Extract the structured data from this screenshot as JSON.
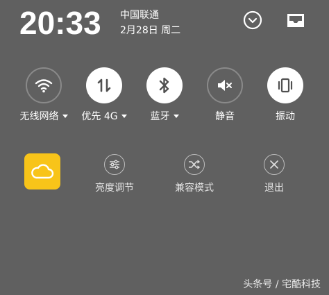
{
  "status": {
    "time": "20:33",
    "carrier": "中国联通",
    "date": "2月28日 周二"
  },
  "header_icons": [
    {
      "icon": "chevron-down-circle-icon"
    },
    {
      "icon": "inbox-icon"
    }
  ],
  "toggles": [
    {
      "label": "无线网络",
      "icon": "wifi-icon",
      "state": "off",
      "has_dropdown": true
    },
    {
      "label": "优先 4G",
      "icon": "mobile-data-icon",
      "state": "on",
      "has_dropdown": true
    },
    {
      "label": "蓝牙",
      "icon": "bluetooth-icon",
      "state": "on",
      "has_dropdown": true
    },
    {
      "label": "静音",
      "icon": "mute-icon",
      "state": "off",
      "has_dropdown": false
    },
    {
      "label": "振动",
      "icon": "vibrate-icon",
      "state": "on",
      "has_dropdown": false
    }
  ],
  "actions": [
    {
      "icon": "cloud-icon",
      "color": "#f8c419"
    },
    {
      "label": "亮度调节",
      "icon": "sliders-icon"
    },
    {
      "label": "兼容模式",
      "icon": "shuffle-icon"
    },
    {
      "label": "退出",
      "icon": "close-icon"
    }
  ],
  "watermark": "头条号 / 宅酷科技",
  "colors": {
    "background": "#606060",
    "accent_yellow": "#f8c419",
    "toggle_on": "#ffffff",
    "toggle_off_border": "#8a8a8a"
  }
}
